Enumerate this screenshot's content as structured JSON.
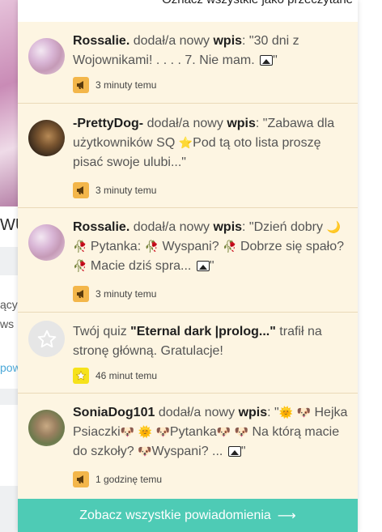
{
  "header": {
    "mark_all_read": "Oznacz wszystkie jako przeczytane"
  },
  "background": {
    "title_fragment": "WU",
    "text_fragment_1": "ący",
    "text_fragment_2": "ws",
    "link_fragment": "pow"
  },
  "notifications": [
    {
      "user": "Rossalie.",
      "action": "dodał/a nowy",
      "type": "wpis",
      "content_1": ": \"30 dni z Wojownikami! . . . . 7. Nie mam.",
      "content_end": "\"",
      "has_image": true,
      "time": "3 minuty temu",
      "icon": "megaphone-icon"
    },
    {
      "user": "-PrettyDog-",
      "action": "dodał/a nowy",
      "type": "wpis",
      "content_1": ": \"Zabawa dla użytkowników SQ",
      "content_emoji": "⭐",
      "content_2": "Pod tą oto lista proszę pisać swoje ulubi...\"",
      "time": "3 minuty temu",
      "icon": "megaphone-icon"
    },
    {
      "user": "Rossalie.",
      "action": "dodał/a nowy",
      "type": "wpis",
      "content_1": ": \"Dzień dobry",
      "content_2": "Pytanka:",
      "content_3": "Wyspani?",
      "content_4": "Dobrze się spało?",
      "content_5": "Macie dziś spra...",
      "content_end": "\"",
      "has_image": true,
      "time": "3 minuty temu",
      "icon": "megaphone-icon"
    },
    {
      "prefix": "Twój quiz",
      "quiz_title": "\"Eternal dark |prolog...\"",
      "suffix": "trafił na stronę główną. Gratulacje!",
      "time": "46 minut temu",
      "icon": "star-icon"
    },
    {
      "user": "SoniaDog101",
      "action": "dodał/a nowy",
      "type": "wpis",
      "content_1": ": \"",
      "content_2": "Hejka Psiaczki",
      "content_3": "Pytanka",
      "content_4": "Na którą macie do szkoły?",
      "content_5": "Wyspani? ...",
      "content_end": "\"",
      "has_image": true,
      "time": "1 godzinę temu",
      "icon": "megaphone-icon"
    }
  ],
  "footer": {
    "see_all": "Zobacz wszystkie powiadomienia",
    "arrow": "⟶"
  },
  "colors": {
    "item_bg": "#fdf5e2",
    "footer_bg": "#4ecbb5",
    "badge_orange": "#f3b64a",
    "badge_yellow": "#f6e21b"
  }
}
